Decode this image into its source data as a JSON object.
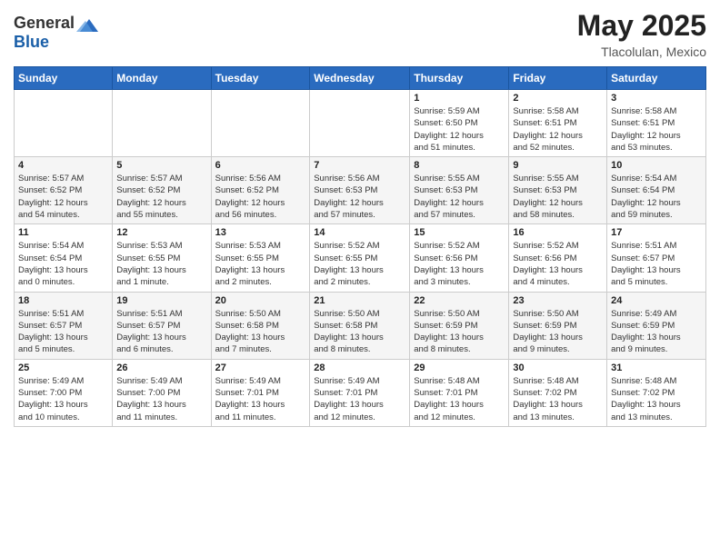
{
  "logo": {
    "general": "General",
    "blue": "Blue"
  },
  "title": "May 2025",
  "subtitle": "Tlacolulan, Mexico",
  "days_of_week": [
    "Sunday",
    "Monday",
    "Tuesday",
    "Wednesday",
    "Thursday",
    "Friday",
    "Saturday"
  ],
  "weeks": [
    [
      {
        "day": "",
        "info": ""
      },
      {
        "day": "",
        "info": ""
      },
      {
        "day": "",
        "info": ""
      },
      {
        "day": "",
        "info": ""
      },
      {
        "day": "1",
        "info": "Sunrise: 5:59 AM\nSunset: 6:50 PM\nDaylight: 12 hours\nand 51 minutes."
      },
      {
        "day": "2",
        "info": "Sunrise: 5:58 AM\nSunset: 6:51 PM\nDaylight: 12 hours\nand 52 minutes."
      },
      {
        "day": "3",
        "info": "Sunrise: 5:58 AM\nSunset: 6:51 PM\nDaylight: 12 hours\nand 53 minutes."
      }
    ],
    [
      {
        "day": "4",
        "info": "Sunrise: 5:57 AM\nSunset: 6:52 PM\nDaylight: 12 hours\nand 54 minutes."
      },
      {
        "day": "5",
        "info": "Sunrise: 5:57 AM\nSunset: 6:52 PM\nDaylight: 12 hours\nand 55 minutes."
      },
      {
        "day": "6",
        "info": "Sunrise: 5:56 AM\nSunset: 6:52 PM\nDaylight: 12 hours\nand 56 minutes."
      },
      {
        "day": "7",
        "info": "Sunrise: 5:56 AM\nSunset: 6:53 PM\nDaylight: 12 hours\nand 57 minutes."
      },
      {
        "day": "8",
        "info": "Sunrise: 5:55 AM\nSunset: 6:53 PM\nDaylight: 12 hours\nand 57 minutes."
      },
      {
        "day": "9",
        "info": "Sunrise: 5:55 AM\nSunset: 6:53 PM\nDaylight: 12 hours\nand 58 minutes."
      },
      {
        "day": "10",
        "info": "Sunrise: 5:54 AM\nSunset: 6:54 PM\nDaylight: 12 hours\nand 59 minutes."
      }
    ],
    [
      {
        "day": "11",
        "info": "Sunrise: 5:54 AM\nSunset: 6:54 PM\nDaylight: 13 hours\nand 0 minutes."
      },
      {
        "day": "12",
        "info": "Sunrise: 5:53 AM\nSunset: 6:55 PM\nDaylight: 13 hours\nand 1 minute."
      },
      {
        "day": "13",
        "info": "Sunrise: 5:53 AM\nSunset: 6:55 PM\nDaylight: 13 hours\nand 2 minutes."
      },
      {
        "day": "14",
        "info": "Sunrise: 5:52 AM\nSunset: 6:55 PM\nDaylight: 13 hours\nand 2 minutes."
      },
      {
        "day": "15",
        "info": "Sunrise: 5:52 AM\nSunset: 6:56 PM\nDaylight: 13 hours\nand 3 minutes."
      },
      {
        "day": "16",
        "info": "Sunrise: 5:52 AM\nSunset: 6:56 PM\nDaylight: 13 hours\nand 4 minutes."
      },
      {
        "day": "17",
        "info": "Sunrise: 5:51 AM\nSunset: 6:57 PM\nDaylight: 13 hours\nand 5 minutes."
      }
    ],
    [
      {
        "day": "18",
        "info": "Sunrise: 5:51 AM\nSunset: 6:57 PM\nDaylight: 13 hours\nand 5 minutes."
      },
      {
        "day": "19",
        "info": "Sunrise: 5:51 AM\nSunset: 6:57 PM\nDaylight: 13 hours\nand 6 minutes."
      },
      {
        "day": "20",
        "info": "Sunrise: 5:50 AM\nSunset: 6:58 PM\nDaylight: 13 hours\nand 7 minutes."
      },
      {
        "day": "21",
        "info": "Sunrise: 5:50 AM\nSunset: 6:58 PM\nDaylight: 13 hours\nand 8 minutes."
      },
      {
        "day": "22",
        "info": "Sunrise: 5:50 AM\nSunset: 6:59 PM\nDaylight: 13 hours\nand 8 minutes."
      },
      {
        "day": "23",
        "info": "Sunrise: 5:50 AM\nSunset: 6:59 PM\nDaylight: 13 hours\nand 9 minutes."
      },
      {
        "day": "24",
        "info": "Sunrise: 5:49 AM\nSunset: 6:59 PM\nDaylight: 13 hours\nand 9 minutes."
      }
    ],
    [
      {
        "day": "25",
        "info": "Sunrise: 5:49 AM\nSunset: 7:00 PM\nDaylight: 13 hours\nand 10 minutes."
      },
      {
        "day": "26",
        "info": "Sunrise: 5:49 AM\nSunset: 7:00 PM\nDaylight: 13 hours\nand 11 minutes."
      },
      {
        "day": "27",
        "info": "Sunrise: 5:49 AM\nSunset: 7:01 PM\nDaylight: 13 hours\nand 11 minutes."
      },
      {
        "day": "28",
        "info": "Sunrise: 5:49 AM\nSunset: 7:01 PM\nDaylight: 13 hours\nand 12 minutes."
      },
      {
        "day": "29",
        "info": "Sunrise: 5:48 AM\nSunset: 7:01 PM\nDaylight: 13 hours\nand 12 minutes."
      },
      {
        "day": "30",
        "info": "Sunrise: 5:48 AM\nSunset: 7:02 PM\nDaylight: 13 hours\nand 13 minutes."
      },
      {
        "day": "31",
        "info": "Sunrise: 5:48 AM\nSunset: 7:02 PM\nDaylight: 13 hours\nand 13 minutes."
      }
    ]
  ]
}
